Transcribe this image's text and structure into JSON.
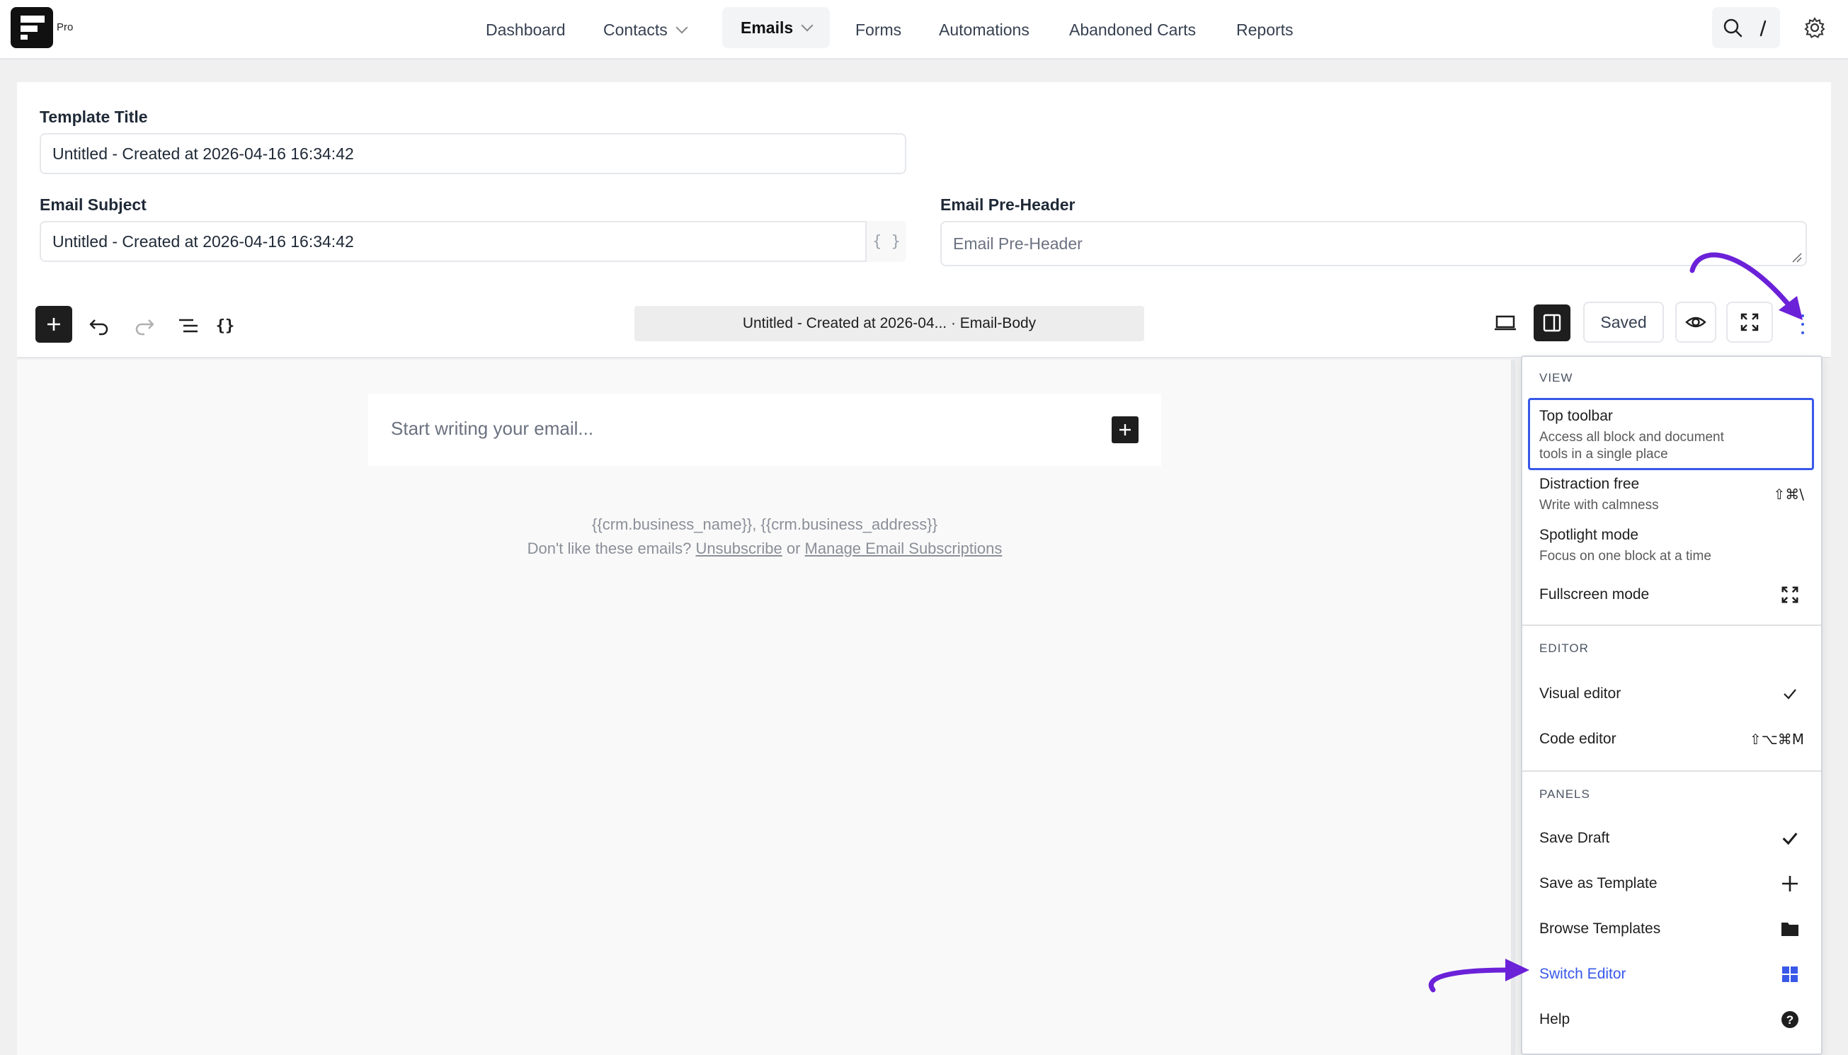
{
  "app": {
    "pro_badge": "Pro"
  },
  "nav": {
    "items": [
      {
        "label": "Dashboard"
      },
      {
        "label": "Contacts"
      },
      {
        "label": "Emails"
      },
      {
        "label": "Forms"
      },
      {
        "label": "Automations"
      },
      {
        "label": "Abandoned Carts"
      },
      {
        "label": "Reports"
      }
    ]
  },
  "form": {
    "template_title_label": "Template Title",
    "template_title_value": "Untitled - Created at 2026-04-16 16:34:42",
    "email_subject_label": "Email Subject",
    "email_subject_value": "Untitled - Created at 2026-04-16 16:34:42",
    "braces": "{ }",
    "preheader_label": "Email Pre-Header",
    "preheader_placeholder": "Email Pre-Header"
  },
  "toolbar": {
    "doc_title": "Untitled - Created at 2026-04... · Email-Body",
    "saved_label": "Saved"
  },
  "canvas": {
    "placeholder": "Start writing your email...",
    "footer_line1": "{{crm.business_name}}, {{crm.business_address}}",
    "footer_prefix": "Don't like these emails?",
    "unsubscribe": "Unsubscribe",
    "or": "or",
    "manage": "Manage Email Subscriptions"
  },
  "menu": {
    "view_title": "VIEW",
    "top_toolbar": "Top toolbar",
    "top_toolbar_desc1": "Access all block and document",
    "top_toolbar_desc2": "tools in a single place",
    "distraction_free": "Distraction free",
    "distraction_free_desc": "Write with calmness",
    "distraction_free_shortcut": "⇧⌘\\",
    "spotlight": "Spotlight mode",
    "spotlight_desc": "Focus on one block at a time",
    "fullscreen": "Fullscreen mode",
    "editor_title": "EDITOR",
    "visual_editor": "Visual editor",
    "code_editor": "Code editor",
    "code_editor_shortcut": "⇧⌥⌘M",
    "panels_title": "PANELS",
    "save_draft": "Save Draft",
    "save_as_template": "Save as Template",
    "browse_templates": "Browse Templates",
    "switch_editor": "Switch Editor",
    "help": "Help"
  },
  "colors": {
    "accent": "#3858e9",
    "annotation_arrow": "#6b21d8"
  }
}
